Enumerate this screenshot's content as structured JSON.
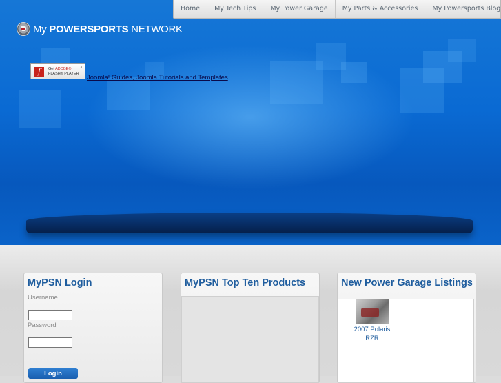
{
  "nav": {
    "items": [
      "Home",
      "My Tech Tips",
      "My Power Garage",
      "My Parts & Accessories",
      "My Powersports Blog"
    ]
  },
  "logo": {
    "prefix": "My ",
    "bold": "POWERSPORTS",
    "suffix": " NETWORK"
  },
  "flash_badge": {
    "line1_prefix": "Get ",
    "line1_brand": "ADOBE®",
    "line2": "FLASH® PLAYER"
  },
  "hero_link": "Joomla! Guides, Joomla Tutorials and Templates",
  "login": {
    "title": "MyPSN Login",
    "username_label": "Username",
    "password_label": "Password",
    "button": "Login"
  },
  "top_ten": {
    "title": "MyPSN Top Ten Products"
  },
  "listings": {
    "title": "New Power Garage Listings",
    "items": [
      {
        "caption_line1": "2007 Polaris",
        "caption_line2": "RZR"
      }
    ]
  },
  "colors": {
    "hero_blue": "#0a6ad3",
    "panel_title": "#1f5d9e",
    "button_blue": "#2f7fd1"
  }
}
